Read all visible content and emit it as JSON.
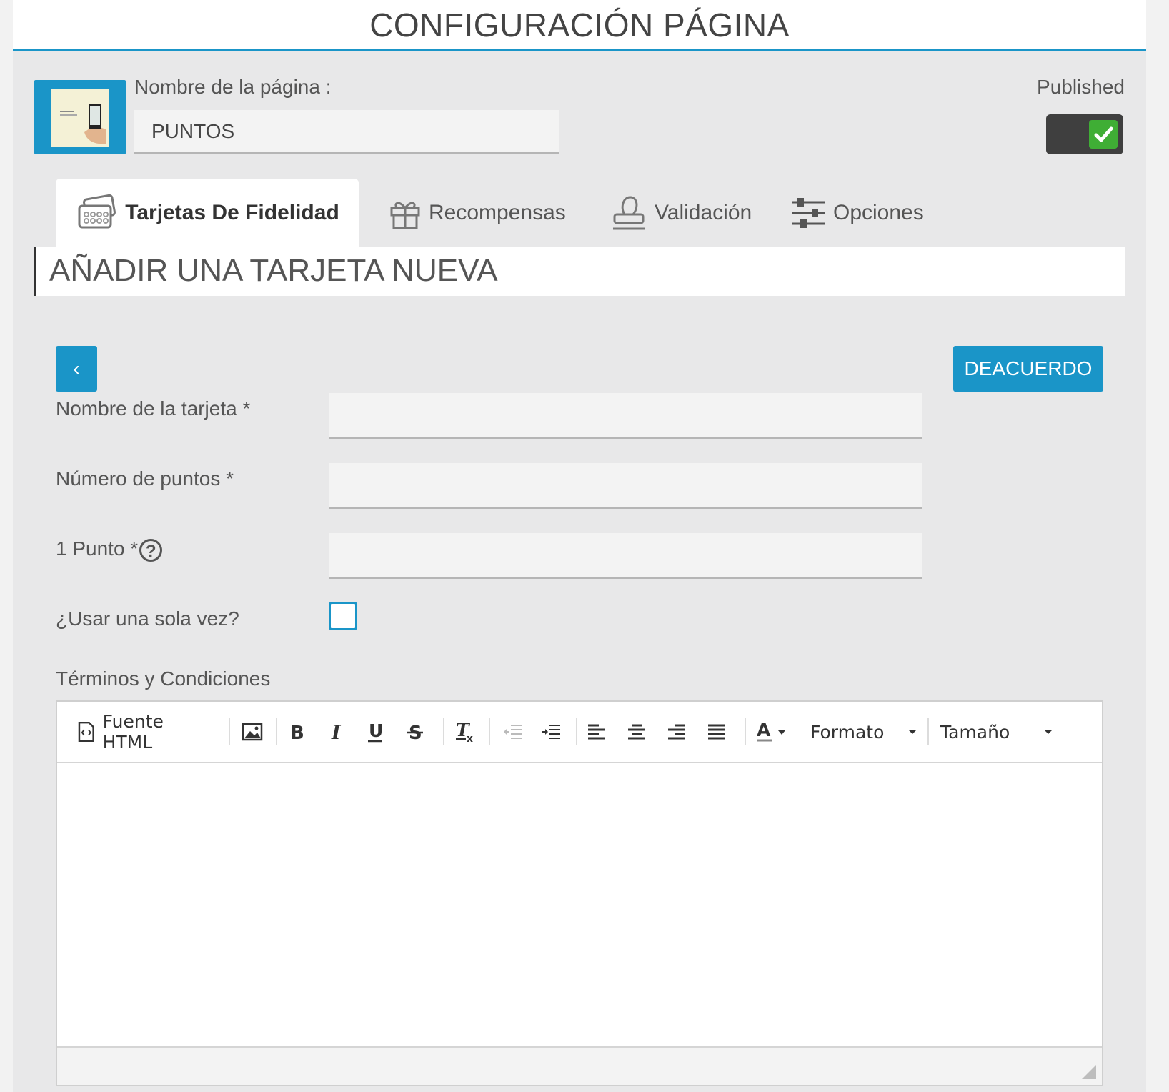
{
  "header": {
    "title": "CONFIGURACIÓN PÁGINA"
  },
  "page": {
    "name_label": "Nombre de la página :",
    "name_value": "PUNTOS",
    "published_label": "Published"
  },
  "tabs": [
    {
      "label": "Tarjetas De Fidelidad",
      "icon": "loyalty-card-icon",
      "active": true
    },
    {
      "label": "Recompensas",
      "icon": "gift-icon",
      "active": false
    },
    {
      "label": "Validación",
      "icon": "stamp-icon",
      "active": false
    },
    {
      "label": "Opciones",
      "icon": "sliders-icon",
      "active": false
    }
  ],
  "section": {
    "title": "AÑADIR UNA TARJETA NUEVA"
  },
  "actions": {
    "back_label": "‹",
    "ok_label": "DEACUERDO"
  },
  "form": {
    "card_name_label": "Nombre de la tarjeta *",
    "points_label": "Número de puntos *",
    "one_point_label": "1 Punto *",
    "help_glyph": "?",
    "use_once_label": "¿Usar una sola vez?",
    "terms_label": "Términos y Condiciones"
  },
  "editor": {
    "source_label": "Fuente HTML",
    "format_label": "Formato",
    "size_label": "Tamaño"
  },
  "colors": {
    "accent": "#1a95c8",
    "toggle_on": "#3fae35",
    "toggle_bg": "#3f3f3f"
  }
}
